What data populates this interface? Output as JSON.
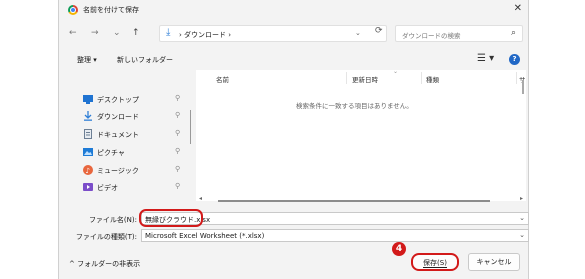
{
  "window": {
    "title": "名前を付けて保存",
    "close_glyph": "✕"
  },
  "nav": {
    "back": "←",
    "forward": "→",
    "recent": "⌄",
    "up": "↑"
  },
  "address": {
    "breadcrumb": "ダウンロード",
    "separator": "›",
    "refresh": "⟳"
  },
  "search": {
    "placeholder": "ダウンロードの検索"
  },
  "toolbar": {
    "organize": "整理 ▾",
    "new_folder": "新しいフォルダー",
    "view": "☰ ▾",
    "help": "?"
  },
  "sidebar": {
    "items": [
      {
        "label": "デスクトップ",
        "icon": "desktop-icon",
        "color": "#1f73d1"
      },
      {
        "label": "ダウンロード",
        "icon": "download-icon",
        "color": "#2f7fd7"
      },
      {
        "label": "ドキュメント",
        "icon": "document-icon",
        "color": "#6d7f94"
      },
      {
        "label": "ピクチャ",
        "icon": "pictures-icon",
        "color": "#1e7bd6"
      },
      {
        "label": "ミュージック",
        "icon": "music-icon",
        "color": "#e8663d"
      },
      {
        "label": "ビデオ",
        "icon": "video-icon",
        "color": "#7b4dc9"
      }
    ],
    "pin_glyph": "📌"
  },
  "file_list": {
    "columns": [
      "名前",
      "更新日時",
      "種類",
      "サ"
    ],
    "empty_message": "検索条件に一致する項目はありません。"
  },
  "form": {
    "filename_label": "ファイル名(N):",
    "filename_value": "無縁びクラウド.xlsx",
    "filetype_label": "ファイルの種類(T):",
    "filetype_value": "Microsoft Excel Worksheet (*.xlsx)"
  },
  "footer": {
    "hide_folders": "^ フォルダーの非表示",
    "save": "保存(S)",
    "cancel": "キャンセル"
  },
  "annotation": {
    "step_number": "4",
    "color": "#d21a1a"
  }
}
